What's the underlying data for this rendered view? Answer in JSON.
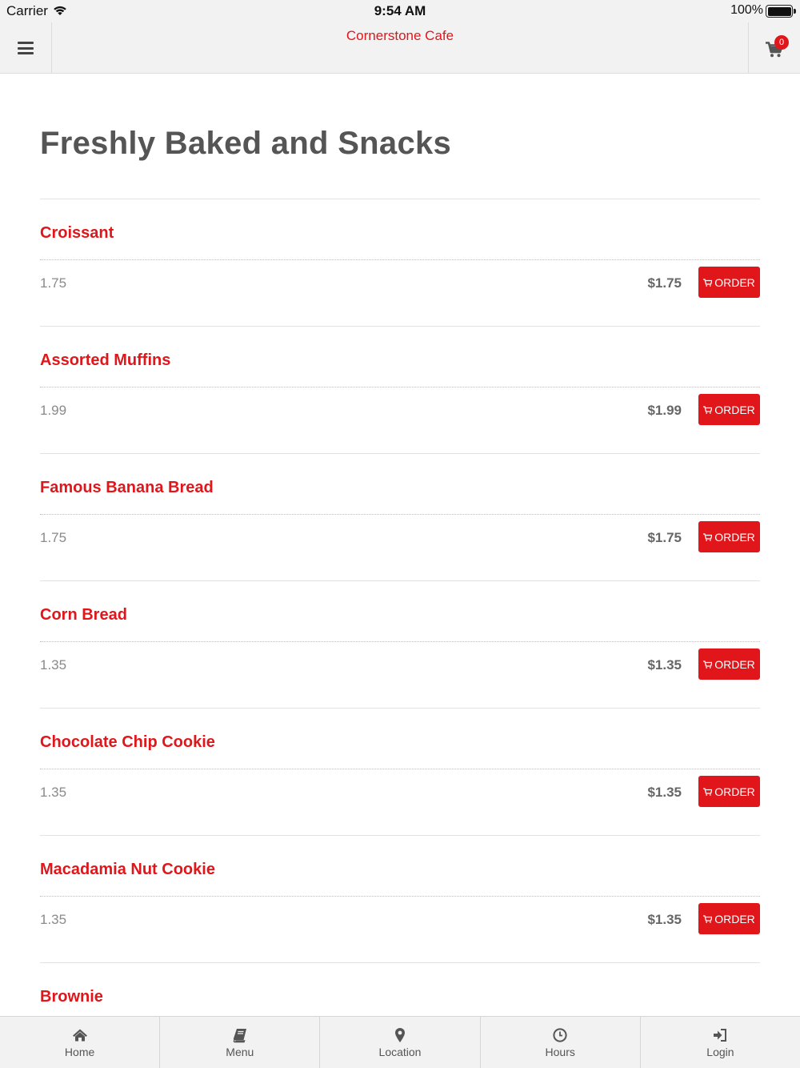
{
  "status_bar": {
    "carrier": "Carrier",
    "time": "9:54 AM",
    "battery": "100%"
  },
  "header": {
    "title": "Cornerstone Cafe",
    "cart_count": "0"
  },
  "page": {
    "title": "Freshly Baked and Snacks"
  },
  "items": [
    {
      "name": "Croissant",
      "description": "1.75",
      "price": "$1.75",
      "order_label": "ORDER"
    },
    {
      "name": "Assorted Muffins",
      "description": "1.99",
      "price": "$1.99",
      "order_label": "ORDER"
    },
    {
      "name": "Famous Banana Bread",
      "description": "1.75",
      "price": "$1.75",
      "order_label": "ORDER"
    },
    {
      "name": "Corn Bread",
      "description": "1.35",
      "price": "$1.35",
      "order_label": "ORDER"
    },
    {
      "name": "Chocolate Chip Cookie",
      "description": "1.35",
      "price": "$1.35",
      "order_label": "ORDER"
    },
    {
      "name": "Macadamia Nut Cookie",
      "description": "1.35",
      "price": "$1.35",
      "order_label": "ORDER"
    },
    {
      "name": "Brownie",
      "description": "",
      "price": "",
      "order_label": ""
    }
  ],
  "tabs": [
    {
      "label": "Home",
      "icon": "home-icon"
    },
    {
      "label": "Menu",
      "icon": "book-icon"
    },
    {
      "label": "Location",
      "icon": "map-pin-icon"
    },
    {
      "label": "Hours",
      "icon": "clock-icon"
    },
    {
      "label": "Login",
      "icon": "sign-in-icon"
    }
  ],
  "colors": {
    "accent": "#e0161b",
    "bar_background": "#f2f2f2",
    "title_gray": "#555555"
  }
}
